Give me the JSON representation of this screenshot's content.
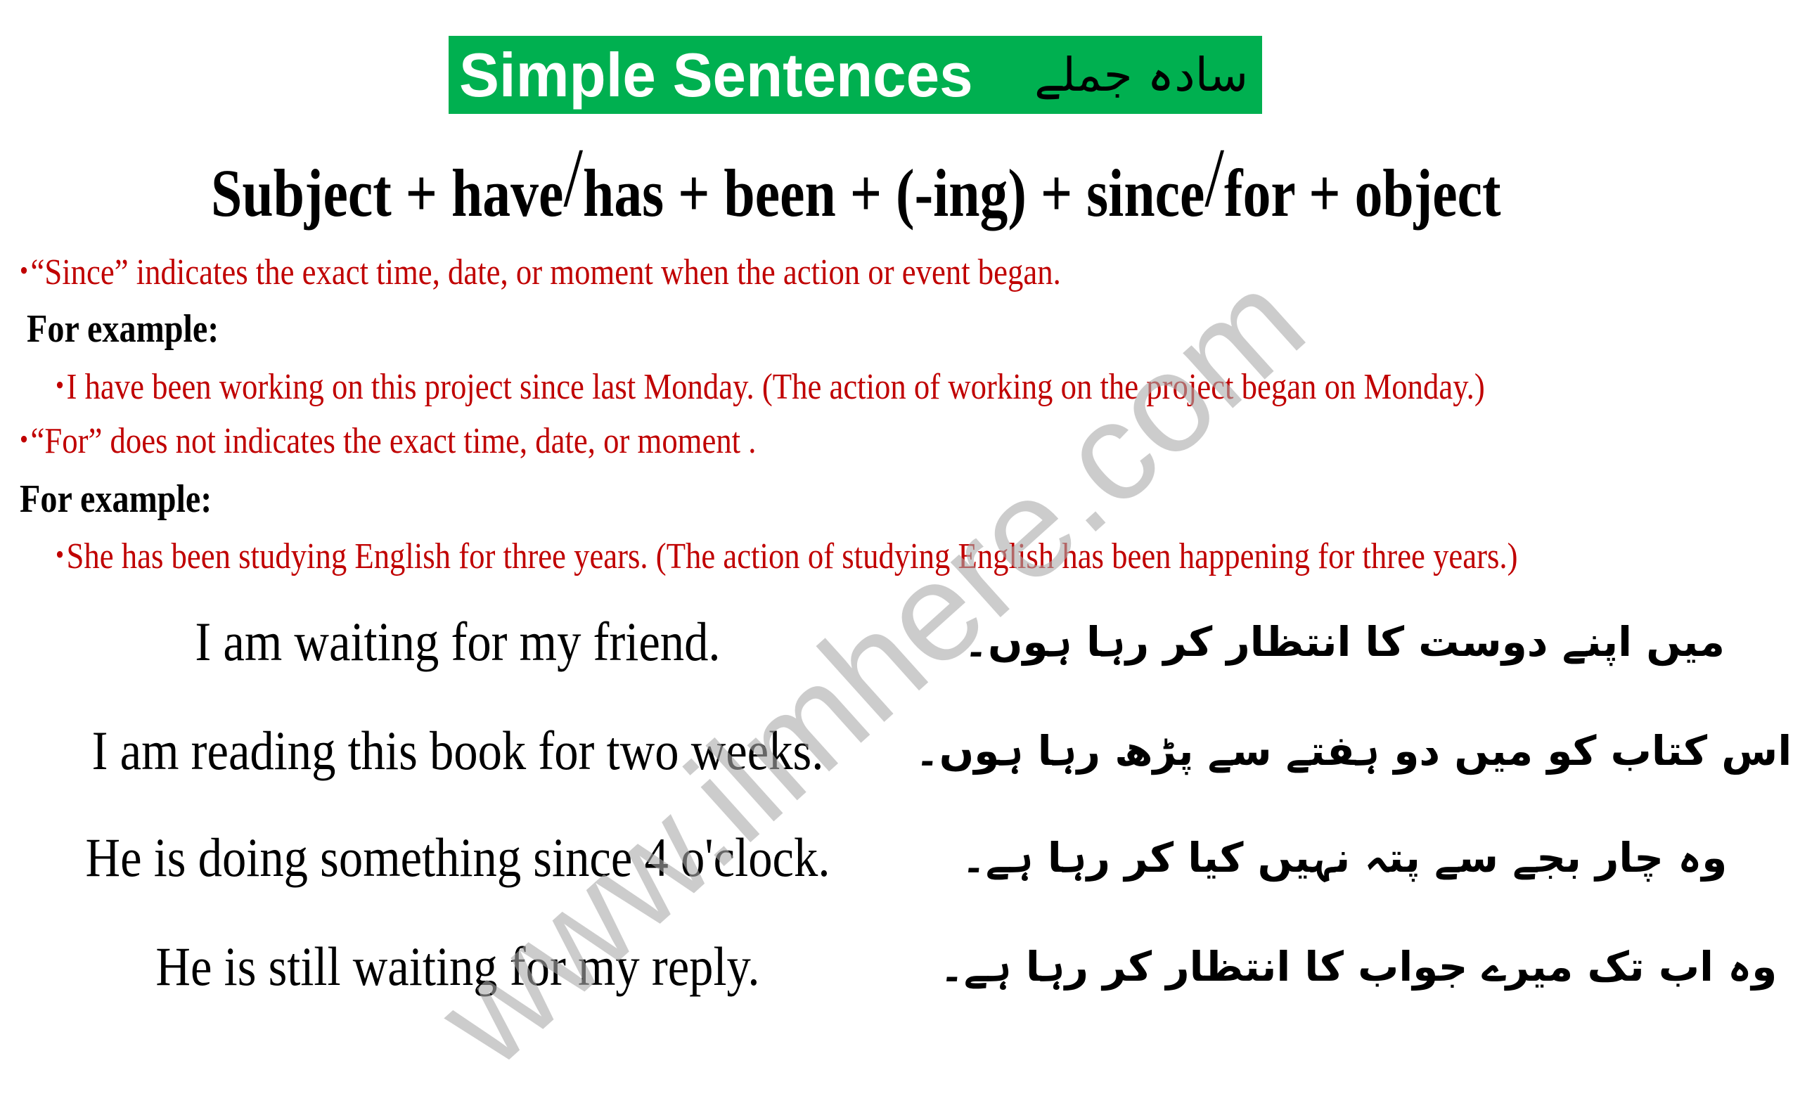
{
  "title": {
    "english": "Simple Sentences",
    "urdu": "سادہ جملے",
    "background_color": "#00B050"
  },
  "formula": {
    "parts": [
      "Subject + have",
      "/",
      "has + been + (-ing) + since",
      "/",
      "for + object"
    ]
  },
  "rules": [
    {
      "bullet": "•",
      "text": "“Since” indicates the exact time, date, or moment when the action or event began."
    },
    {
      "label": "For example:"
    },
    {
      "bullet": "•",
      "text": "I have been working on this project since last Monday. (The action of working on the project began on Monday.)"
    },
    {
      "bullet": "•",
      "text": "“For” does not indicates the exact time, date, or moment ."
    },
    {
      "label": "For example:"
    },
    {
      "bullet": "•",
      "text": "She has been studying English for three years. (The action of studying English has been happening for three years.)"
    }
  ],
  "sentences": [
    {
      "english": "I am waiting for my friend.",
      "urdu": "میں اپنے دوست کا انتظار کر رہا ہوں۔"
    },
    {
      "english": "I  am reading this book for two weeks.",
      "urdu": "اس کتاب کو میں دو ہفتے سے پڑھ رہا ہوں۔"
    },
    {
      "english": "He is doing something since 4 o'clock.",
      "urdu": "وہ چار بجے سے پتہ نہیں کیا کر رہا ہے۔"
    },
    {
      "english": "He is still waiting for my reply.",
      "urdu": "وہ اب تک میرے جواب کا انتظار کر رہا ہے۔"
    }
  ],
  "watermark": "www.ilmhere.com",
  "colors": {
    "rule_text": "#C00000",
    "body_text": "#000000"
  }
}
